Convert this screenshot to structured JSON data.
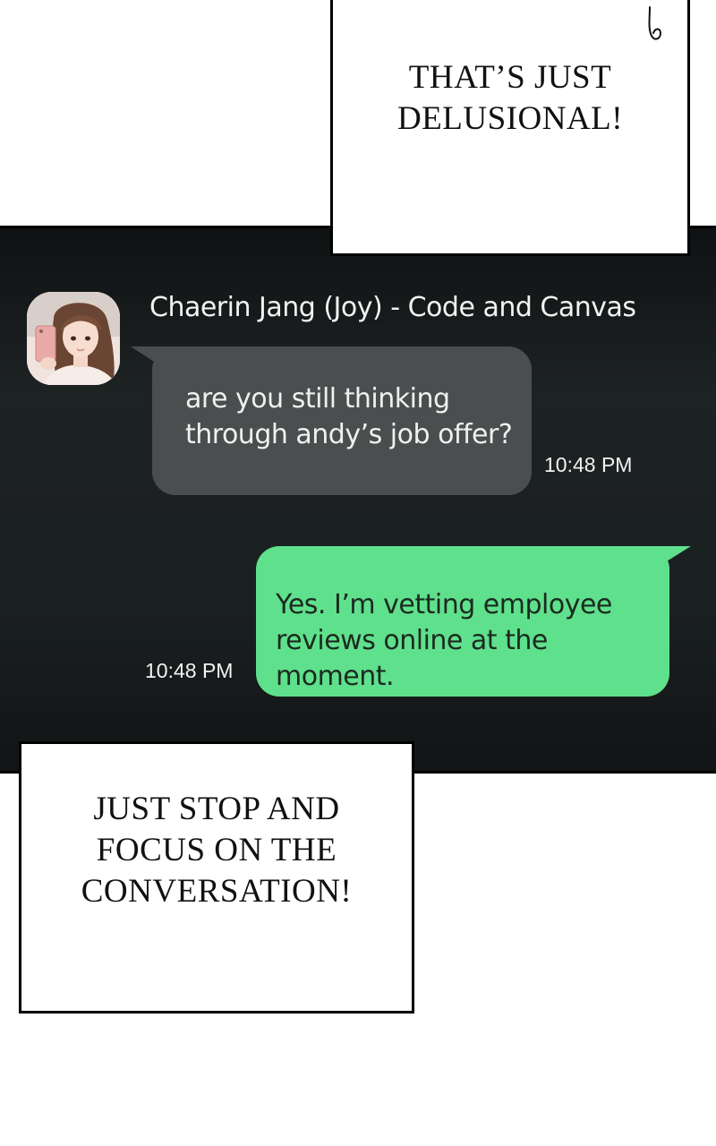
{
  "captions": {
    "top": "THAT’S JUST\nDELUSIONAL!",
    "bottom": "JUST STOP AND\nFOCUS ON THE\nCONVERSATION!"
  },
  "chat": {
    "sender_name": "Chaerin Jang (Joy) - Code and Canvas",
    "incoming_message": {
      "text": "are you still thinking\nthrough andy’s job offer?",
      "time": "10:48 PM"
    },
    "outgoing_message": {
      "text": "Yes. I’m vetting employee\nreviews online at the moment.",
      "time": "10:48 PM"
    }
  },
  "colors": {
    "panel_background": "#1a1f20",
    "incoming_bubble": "#4b4e4f",
    "outgoing_bubble": "#5fe08c"
  }
}
